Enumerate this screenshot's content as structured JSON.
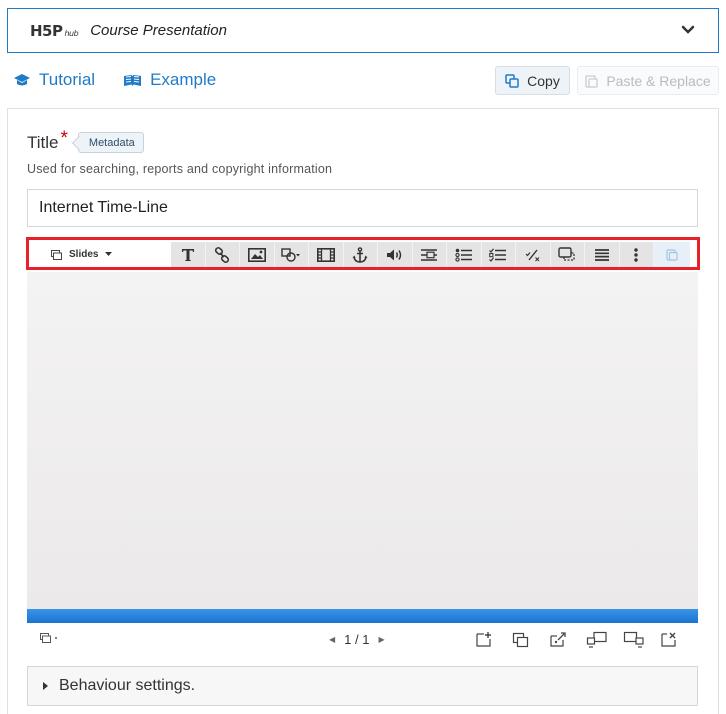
{
  "hub": {
    "logo_main": "H5P",
    "logo_sub": "hub",
    "content_type": "Course Presentation"
  },
  "links": {
    "tutorial": "Tutorial",
    "example": "Example"
  },
  "actions": {
    "copy": "Copy",
    "paste_replace": "Paste & Replace"
  },
  "form": {
    "title_label": "Title",
    "required_mark": "*",
    "metadata_label": "Metadata",
    "title_description": "Used for searching, reports and copyright information",
    "title_value": "Internet Time-Line"
  },
  "editor": {
    "slides_dropdown": "Slides",
    "toolbar_icons": [
      "text-icon",
      "link-icon",
      "image-icon",
      "shapes-icon",
      "video-icon",
      "anchor-icon",
      "audio-icon",
      "fill-in-blanks-icon",
      "single-choice-icon",
      "multiple-choice-icon",
      "true-false-icon",
      "dialog-cards-icon",
      "summary-icon",
      "more-icon",
      "paste-icon"
    ],
    "pager": {
      "current": "1",
      "separator": "/",
      "total": "1"
    }
  },
  "behaviour_settings": "Behaviour settings.",
  "colors": {
    "accent": "#1f7bc7",
    "highlight": "#e8202a",
    "progress": "#2a86dd"
  }
}
